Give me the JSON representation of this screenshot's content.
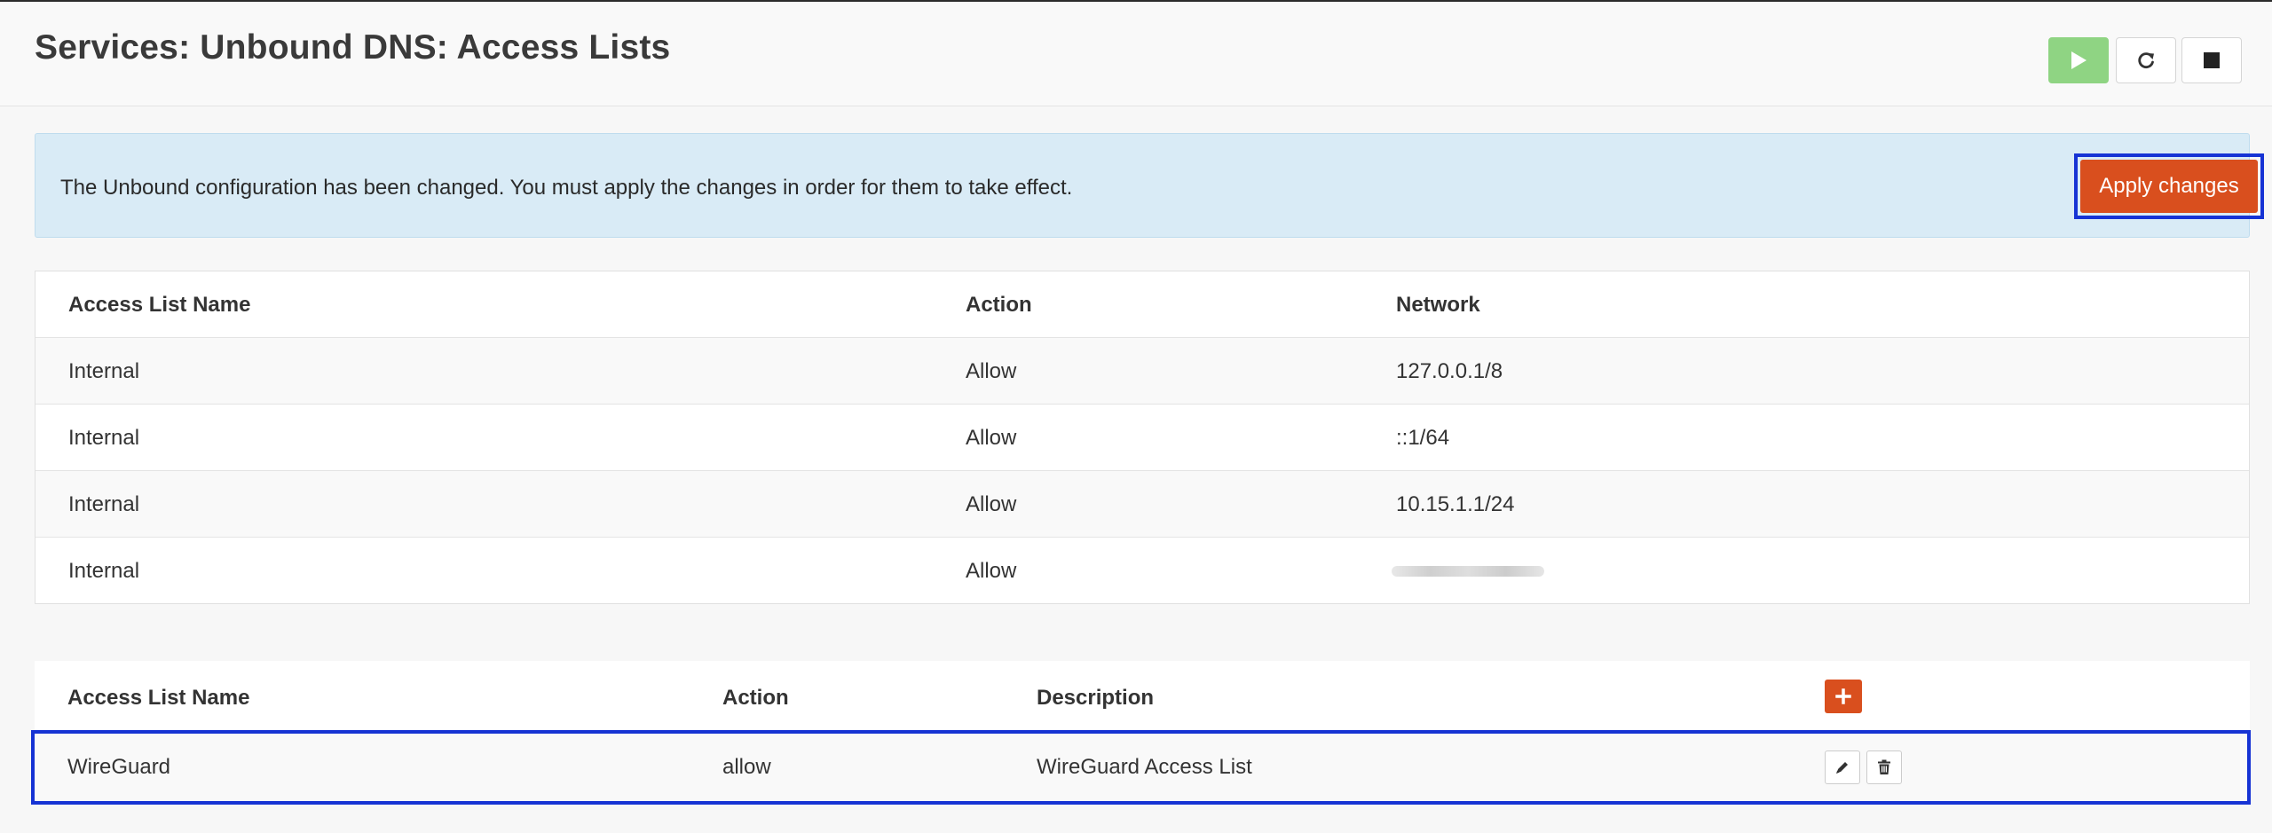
{
  "page": {
    "title": "Services: Unbound DNS: Access Lists"
  },
  "service_controls": {
    "start_icon": "play-icon",
    "restart_icon": "restart-icon",
    "stop_icon": "stop-icon"
  },
  "alert": {
    "message": "The Unbound configuration has been changed. You must apply the changes in order for them to take effect.",
    "apply_label": "Apply changes"
  },
  "default_acl_table": {
    "headers": [
      "Access List Name",
      "Action",
      "Network"
    ],
    "rows": [
      [
        "Internal",
        "Allow",
        "127.0.0.1/8"
      ],
      [
        "Internal",
        "Allow",
        "::1/64"
      ],
      [
        "Internal",
        "Allow",
        "10.15.1.1/24"
      ],
      [
        "Internal",
        "Allow",
        ""
      ]
    ]
  },
  "custom_acl_table": {
    "headers": [
      "Access List Name",
      "Action",
      "Description"
    ],
    "add_icon": "plus-icon",
    "rows": [
      [
        "WireGuard",
        "allow",
        "WireGuard Access List"
      ]
    ],
    "edit_icon": "pencil-icon",
    "delete_icon": "trash-icon"
  },
  "colors": {
    "accent": "#d94f1e",
    "start_green": "#8fd483",
    "alert_bg": "#d9ebf6",
    "highlight_border": "#1633d4"
  }
}
